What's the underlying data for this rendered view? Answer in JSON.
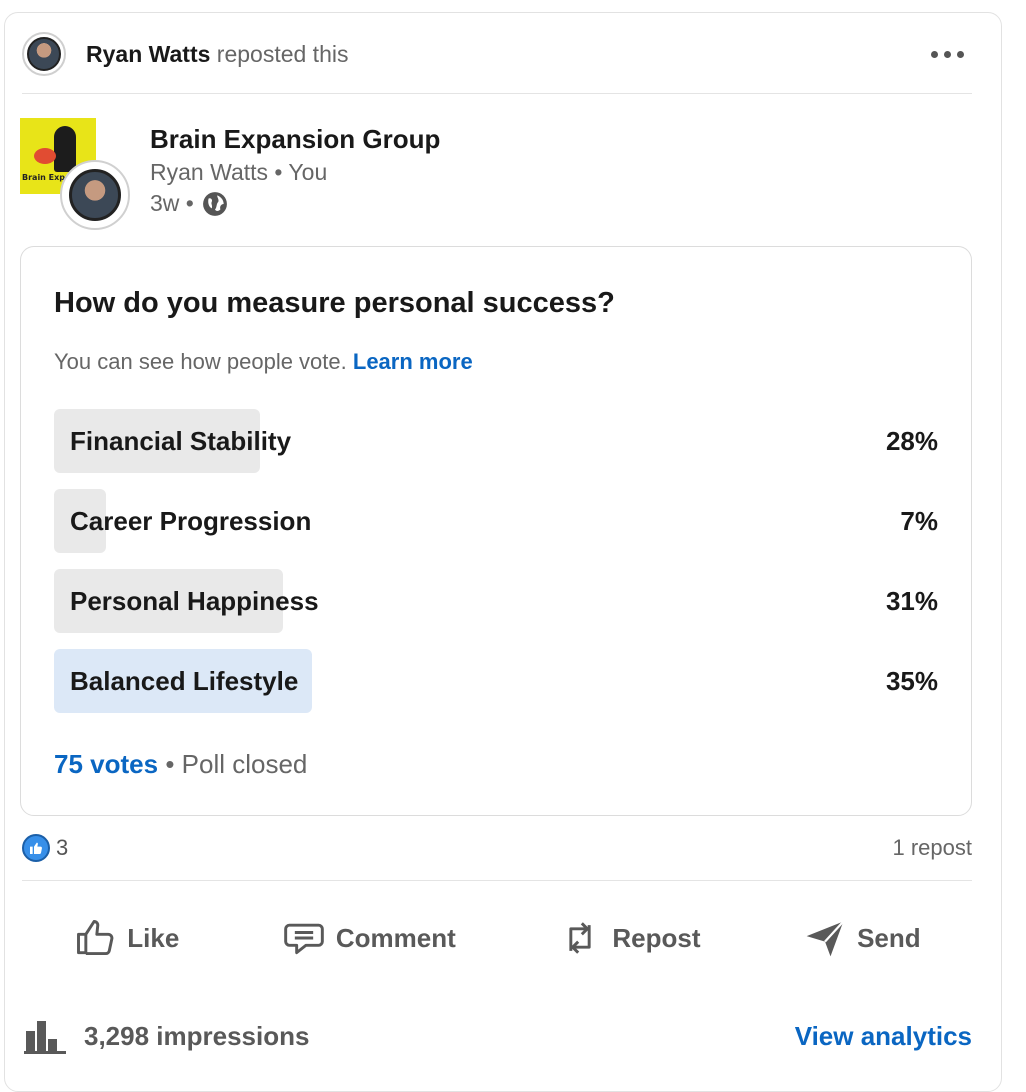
{
  "repost_header": {
    "user_name": "Ryan Watts",
    "action_text": "reposted this",
    "menu_icon": "more-horizontal-icon"
  },
  "post_author": {
    "name": "Brain Expansion Group",
    "subtitle": "Ryan Watts • You",
    "time": "3w •",
    "visibility_icon": "globe-icon",
    "logo_text": "Brain Expan"
  },
  "poll": {
    "question": "How do you measure personal success?",
    "note": "You can see how people vote.",
    "learn_more": "Learn more",
    "options": [
      {
        "label": "Financial Stability",
        "percent_label": "28%",
        "percent": 28,
        "winner": false
      },
      {
        "label": "Career Progression",
        "percent_label": "7%",
        "percent": 7,
        "winner": false
      },
      {
        "label": "Personal Happiness",
        "percent_label": "31%",
        "percent": 31,
        "winner": false
      },
      {
        "label": "Balanced Lifestyle",
        "percent_label": "35%",
        "percent": 35,
        "winner": true
      }
    ],
    "votes": "75 votes",
    "status": "• Poll closed"
  },
  "social_counts": {
    "like_icon": "thumbs-up-icon",
    "likes": "3",
    "reposts": "1 repost"
  },
  "actions": {
    "like": "Like",
    "comment": "Comment",
    "repost": "Repost",
    "send": "Send"
  },
  "analytics": {
    "icon": "bar-chart-icon",
    "impressions": "3,298 impressions",
    "view_link": "View analytics"
  },
  "colors": {
    "link_blue": "#0a66c2",
    "poll_fill": "#e9e9e9",
    "poll_winner_fill": "#dce8f7",
    "like_blue": "#378fe9"
  }
}
